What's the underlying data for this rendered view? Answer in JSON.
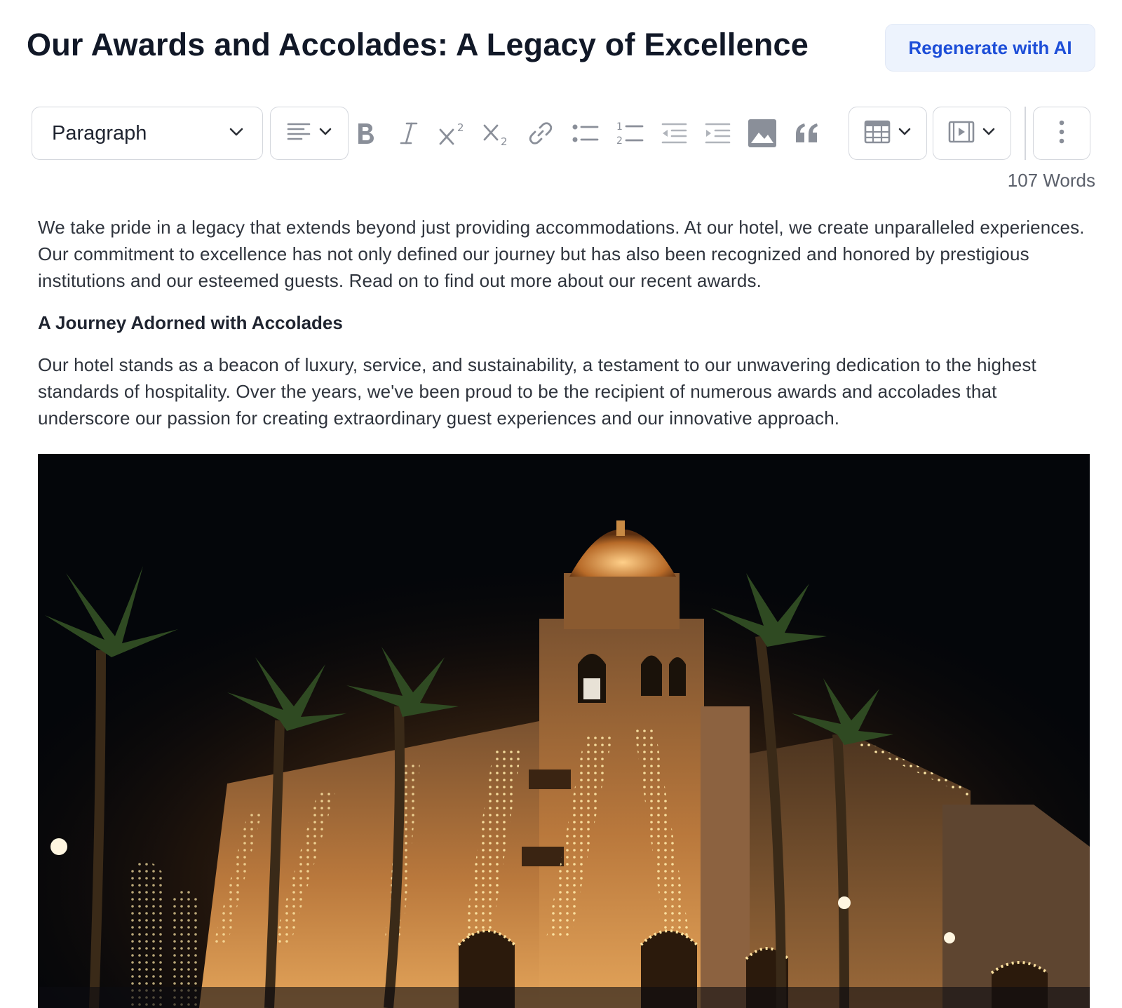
{
  "header": {
    "title": "Our Awards and Accolades: A Legacy of Excellence",
    "regenerate_label": "Regenerate with AI"
  },
  "toolbar": {
    "block_type": "Paragraph",
    "icons": [
      "align-left-icon",
      "bold-icon",
      "italic-icon",
      "superscript-icon",
      "subscript-icon",
      "link-icon",
      "bullet-list-icon",
      "numbered-list-icon",
      "outdent-icon",
      "indent-icon",
      "image-icon",
      "quote-icon",
      "table-icon",
      "video-icon",
      "more-vertical-icon"
    ]
  },
  "word_count": "107 Words",
  "article": {
    "paragraph1": "We take pride in a legacy that extends beyond just providing accommodations. At our hotel, we create unparalleled experiences. Our commitment to excellence has not only defined our journey but has also been recognized and honored by prestigious institutions and our esteemed guests. Read on to find out more about our recent awards.",
    "subheading": "A Journey Adorned with Accolades",
    "paragraph2": "Our hotel stands as a beacon of luxury, service, and sustainability, a testament to our unwavering dedication to the highest standards of hospitality. Over the years, we've been proud to be the recipient of numerous awards and accolades that underscore our passion for creating extraordinary guest experiences and our innovative approach."
  },
  "colors": {
    "accent": "#1d4ed8",
    "accent_bg": "#edf3fd",
    "icon_gray": "#8a8f99",
    "text": "#2f343d"
  }
}
